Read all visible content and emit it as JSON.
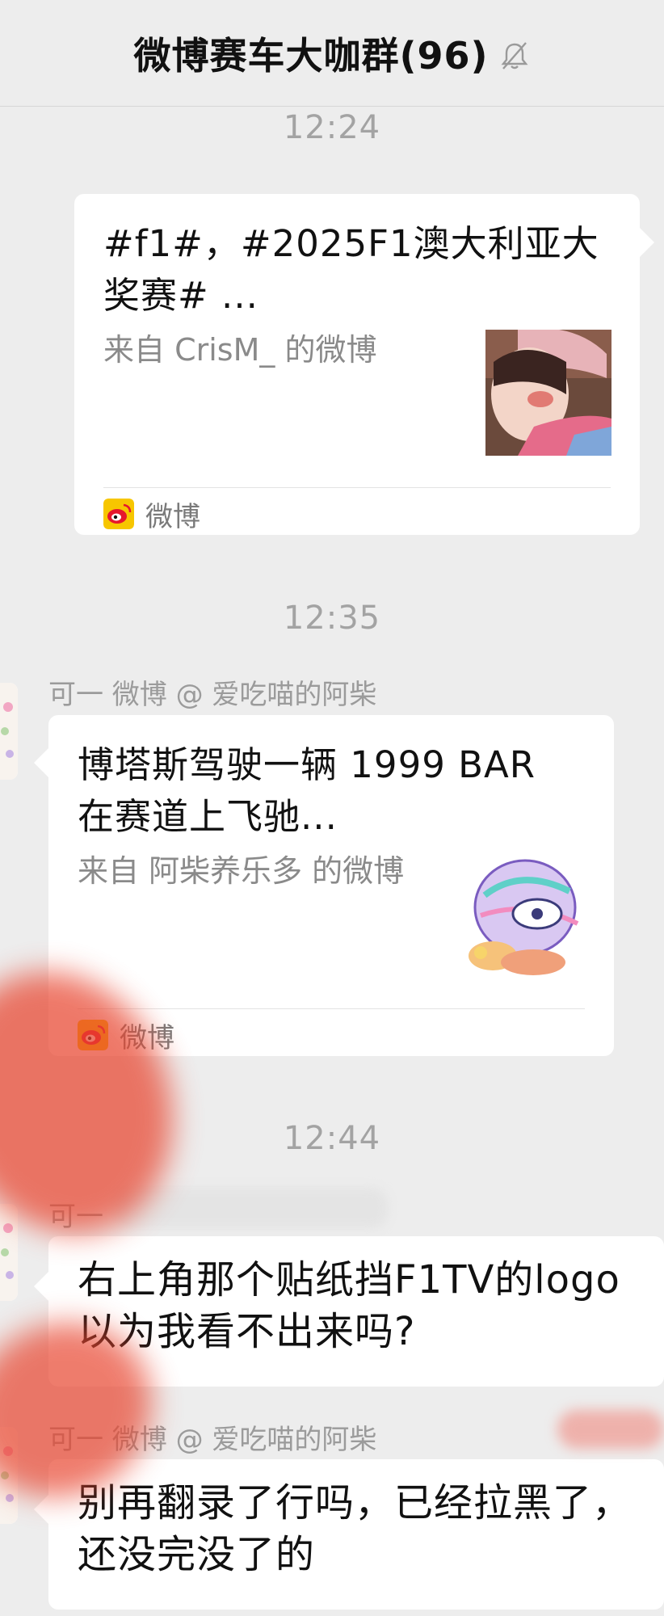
{
  "header": {
    "title": "微博赛车大咖群(96)",
    "mute_icon": "bell-muted-icon"
  },
  "timestamps": [
    "12:24",
    "12:35",
    "12:44"
  ],
  "messages": [
    {
      "type": "weibo-card",
      "sender": "",
      "side": "right",
      "title": "#f1#，#2025F1澳大利亚大奖赛# ...",
      "source": "来自 CrisM_ 的微博",
      "footer": "微博"
    },
    {
      "type": "weibo-card",
      "sender": "可一 微博 @ 爱吃喵的阿柴",
      "side": "left",
      "title": "博塔斯驾驶一辆 1999 BAR 在赛道上飞驰...",
      "source": "来自 阿柴养乐多 的微博",
      "footer": "微博"
    },
    {
      "type": "text",
      "sender": "可一",
      "side": "left",
      "text": "右上角那个贴纸挡F1TV的logo以为我看不出来吗?"
    },
    {
      "type": "text",
      "sender": "可一 微博 @ 爱吃喵的阿柴",
      "side": "left",
      "text": "别再翻录了行吗，已经拉黑了，还没完没了的"
    }
  ],
  "colors": {
    "background": "#ededed",
    "bubble": "#ffffff",
    "weibo_red": "#e6162d",
    "weibo_yellow": "#f7c600"
  }
}
